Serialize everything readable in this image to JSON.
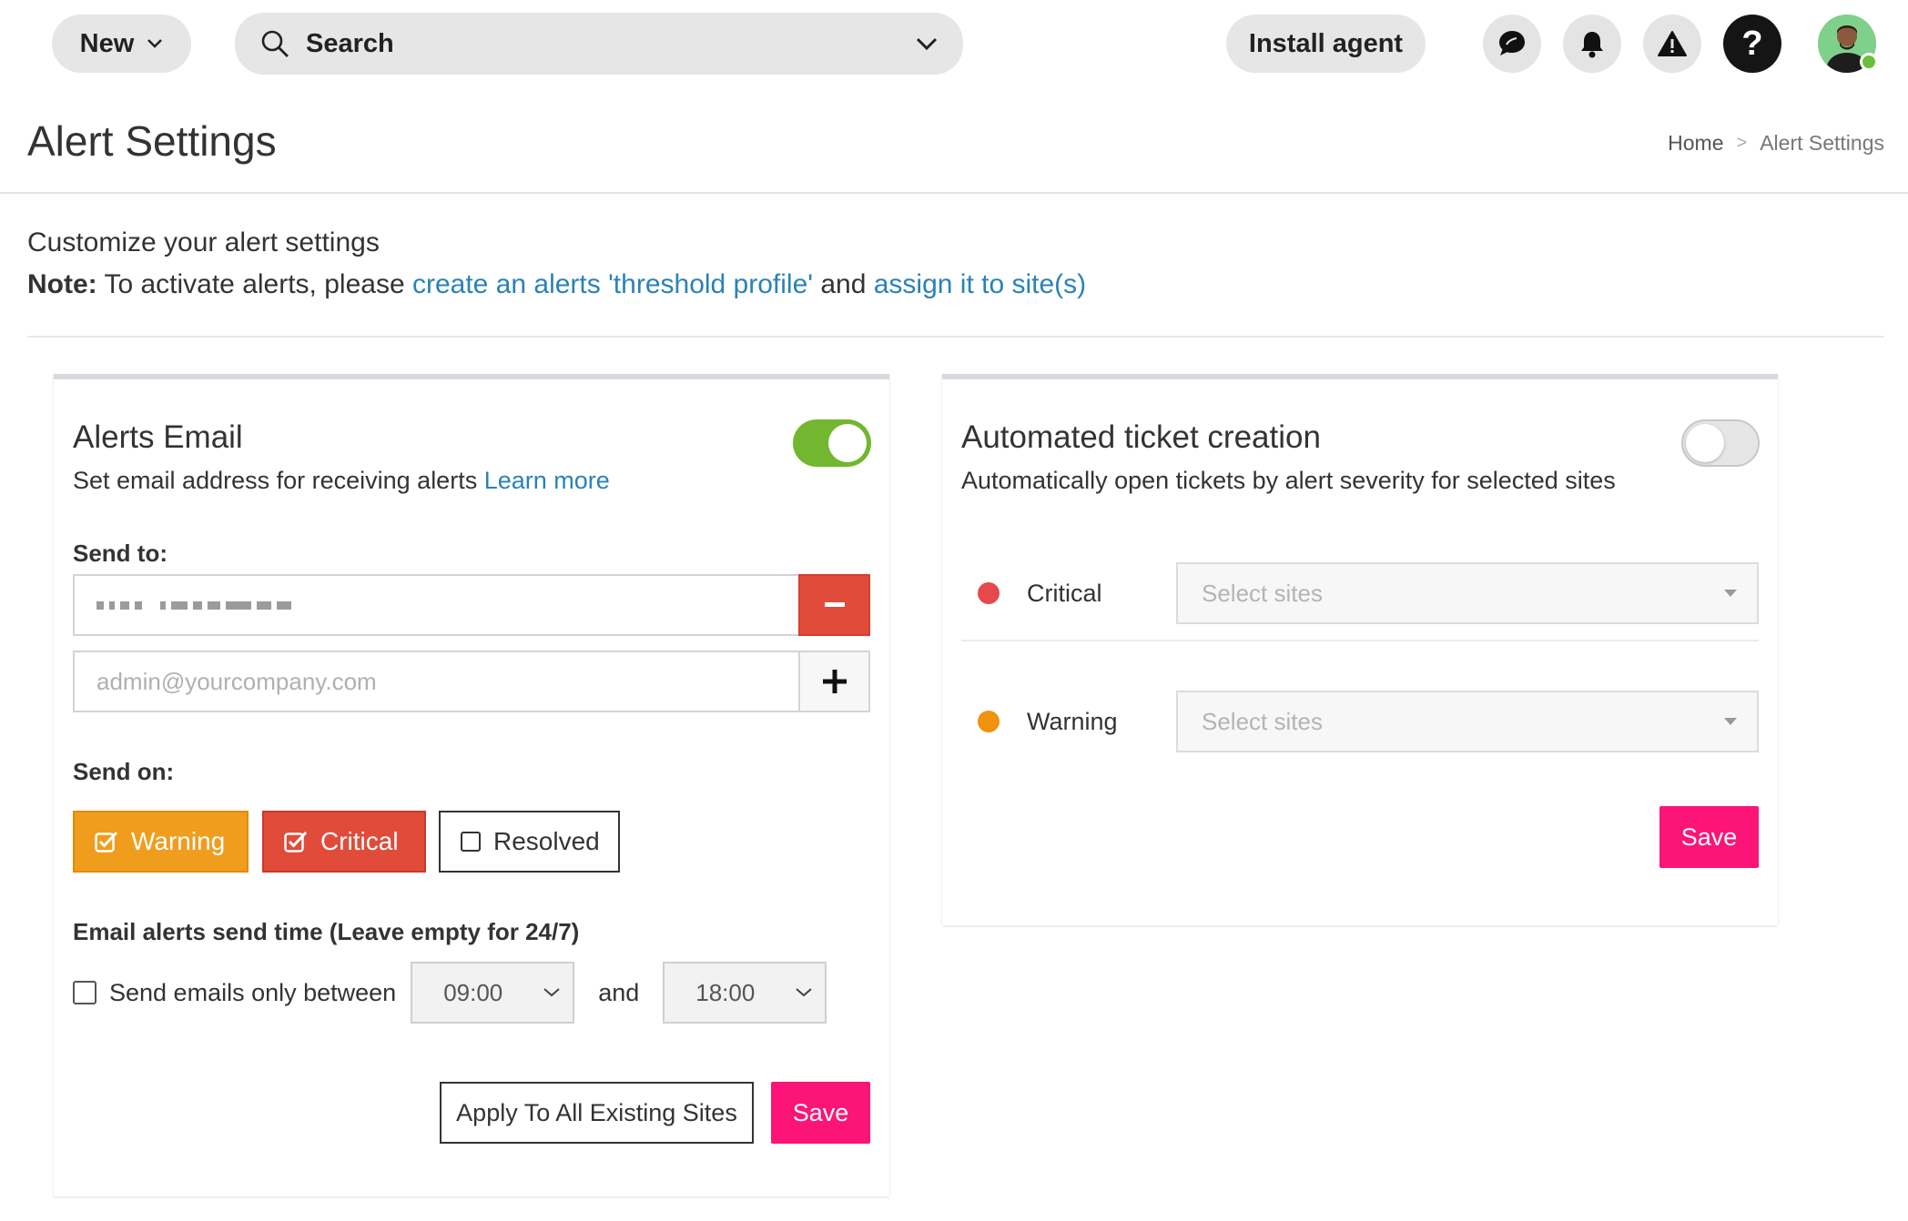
{
  "topbar": {
    "new_label": "New",
    "search_placeholder": "Search",
    "install_label": "Install agent",
    "help_label": "?",
    "icons": [
      "chevron-down-icon",
      "search-icon",
      "chat-icon",
      "bell-icon",
      "alert-triangle-icon",
      "help-icon"
    ]
  },
  "header": {
    "title": "Alert Settings",
    "breadcrumb": {
      "home": "Home",
      "sep": ">",
      "current": "Alert Settings"
    }
  },
  "intro": {
    "line1": "Customize your alert settings",
    "note_label": "Note:",
    "note_text": " To activate alerts, please ",
    "link1": "create an alerts 'threshold profile'",
    "and_text": " and ",
    "link2": "assign it to site(s)"
  },
  "email_card": {
    "title": "Alerts Email",
    "subtitle": "Set email address for receiving alerts ",
    "learn_more": "Learn more",
    "toggle_on": true,
    "send_to_label": "Send to:",
    "new_email_placeholder": "admin@yourcompany.com",
    "send_on_label": "Send on:",
    "send_on": [
      {
        "label": "Warning",
        "checked": true
      },
      {
        "label": "Critical",
        "checked": true
      },
      {
        "label": "Resolved",
        "checked": false
      }
    ],
    "send_time_label": "Email alerts send time (Leave empty for 24/7)",
    "only_between_label": "Send emails only between",
    "from_time": "09:00",
    "and_label": "and",
    "to_time": "18:00",
    "apply_label": "Apply To All Existing Sites",
    "save_label": "Save"
  },
  "ticket_card": {
    "title": "Automated ticket creation",
    "subtitle": "Automatically open tickets by alert severity for selected sites",
    "toggle_on": false,
    "rows": [
      {
        "label": "Critical",
        "placeholder": "Select sites",
        "color": "#e5484d"
      },
      {
        "label": "Warning",
        "placeholder": "Select sites",
        "color": "#f0920f"
      }
    ],
    "save_label": "Save"
  },
  "colors": {
    "accent_pink": "#fc1476",
    "link_blue": "#2a82b7",
    "toggle_green": "#72b72f",
    "warning_orange": "#f09d1d",
    "critical_red": "#e04b3a"
  }
}
